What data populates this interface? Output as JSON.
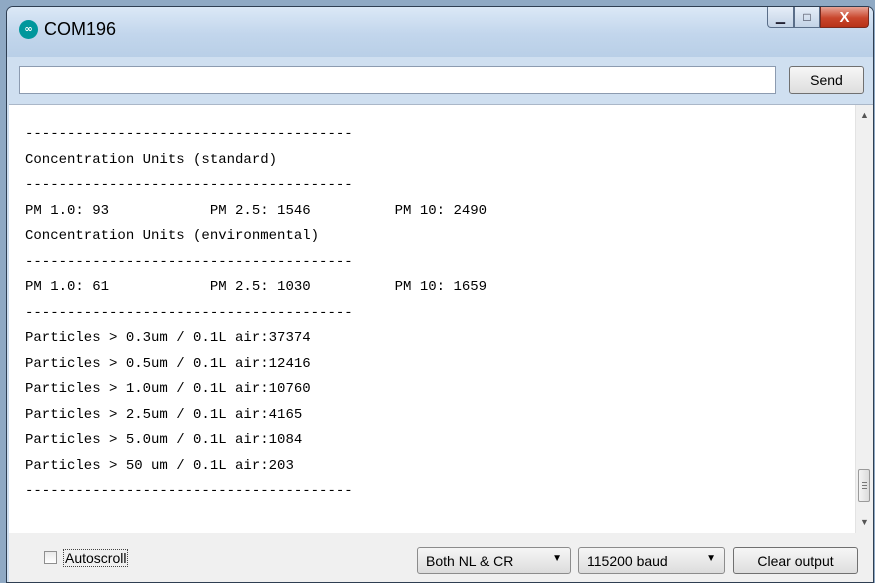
{
  "window": {
    "title": "COM196",
    "icon": "arduino-icon",
    "icon_glyph": "∞"
  },
  "controls": {
    "minimize_glyph": "▁",
    "maximize_glyph": "□",
    "close_glyph": "X"
  },
  "input": {
    "value": "",
    "send_label": "Send"
  },
  "console": {
    "lines": [
      "---------------------------------------",
      "Concentration Units (standard)",
      "---------------------------------------",
      "PM 1.0: 93            PM 2.5: 1546          PM 10: 2490",
      "Concentration Units (environmental)",
      "---------------------------------------",
      "PM 1.0: 61            PM 2.5: 1030          PM 10: 1659",
      "---------------------------------------",
      "Particles > 0.3um / 0.1L air:37374",
      "Particles > 0.5um / 0.1L air:12416",
      "Particles > 1.0um / 0.1L air:10760",
      "Particles > 2.5um / 0.1L air:4165",
      "Particles > 5.0um / 0.1L air:1084",
      "Particles > 50 um / 0.1L air:203",
      "---------------------------------------"
    ]
  },
  "statusbar": {
    "autoscroll_label": "Autoscroll",
    "autoscroll_checked": false,
    "line_ending": "Both NL & CR",
    "baud_rate": "115200 baud",
    "clear_label": "Clear output"
  },
  "colors": {
    "titlebar": "#c2d6ec",
    "close": "#c9462c",
    "arduino": "#00979c"
  }
}
